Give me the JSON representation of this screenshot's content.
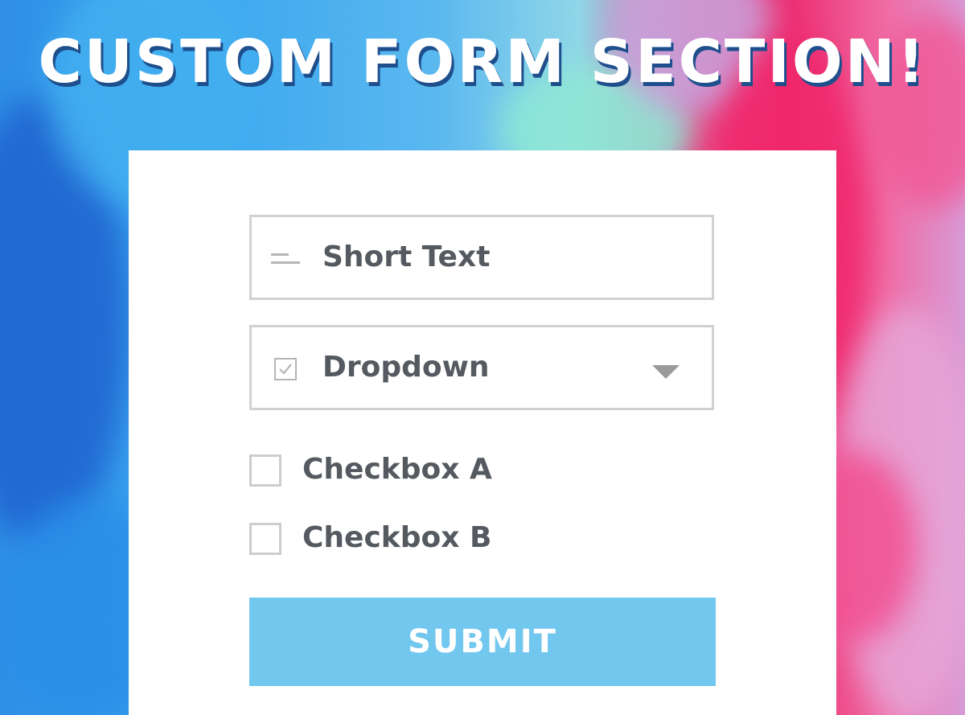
{
  "heading": "CUSTOM FORM SECTION!",
  "form": {
    "short_text": {
      "label": "Short Text",
      "icon": "text-lines-icon"
    },
    "dropdown": {
      "label": "Dropdown",
      "icon": "checkmark-square-icon",
      "caret": "chevron-down-icon"
    },
    "checkboxes": [
      {
        "label": "Checkbox A",
        "checked": false
      },
      {
        "label": "Checkbox B",
        "checked": false
      }
    ],
    "submit_label": "SUBMIT"
  },
  "colors": {
    "submit_bg": "#72c7ee",
    "text": "#555a60",
    "border": "#d1d1d1"
  }
}
